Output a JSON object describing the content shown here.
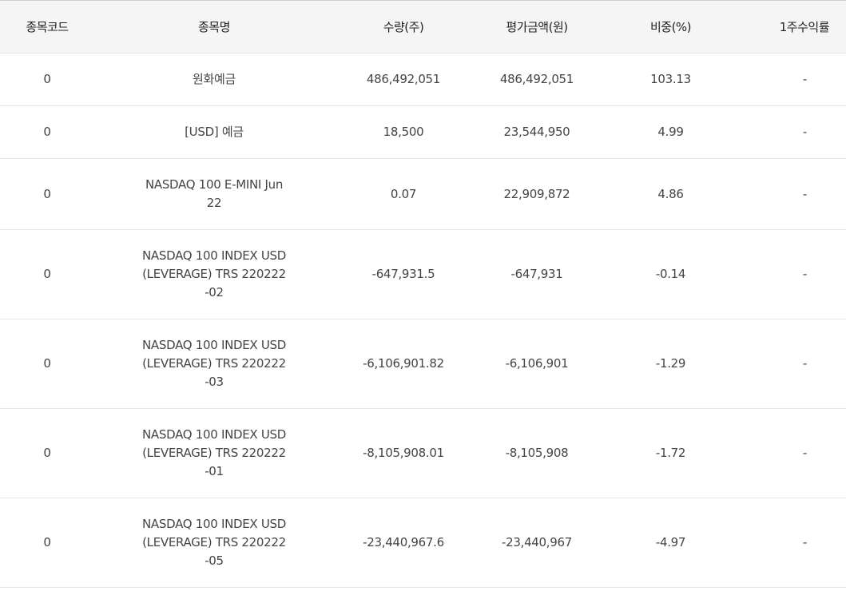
{
  "table": {
    "headers": [
      "종목코드",
      "종목명",
      "수량(주)",
      "평가금액(원)",
      "비중(%)",
      "1주수익률"
    ],
    "rows": [
      {
        "code": "0",
        "name": "원화예금",
        "qty": "486,492,051",
        "value": "486,492,051",
        "weight": "103.13",
        "ret": "-"
      },
      {
        "code": "0",
        "name": "[USD] 예금",
        "qty": "18,500",
        "value": "23,544,950",
        "weight": "4.99",
        "ret": "-"
      },
      {
        "code": "0",
        "name": "NASDAQ 100 E-MINI Jun 22",
        "qty": "0.07",
        "value": "22,909,872",
        "weight": "4.86",
        "ret": "-"
      },
      {
        "code": "0",
        "name": "NASDAQ 100 INDEX USD (LEVERAGE) TRS 220222 -02",
        "qty": "-647,931.5",
        "value": "-647,931",
        "weight": "-0.14",
        "ret": "-"
      },
      {
        "code": "0",
        "name": "NASDAQ 100 INDEX USD (LEVERAGE) TRS 220222 -03",
        "qty": "-6,106,901.82",
        "value": "-6,106,901",
        "weight": "-1.29",
        "ret": "-"
      },
      {
        "code": "0",
        "name": "NASDAQ 100 INDEX USD (LEVERAGE) TRS 220222 -01",
        "qty": "-8,105,908.01",
        "value": "-8,105,908",
        "weight": "-1.72",
        "ret": "-"
      },
      {
        "code": "0",
        "name": "NASDAQ 100 INDEX USD (LEVERAGE) TRS 220222 -05",
        "qty": "-23,440,967.6",
        "value": "-23,440,967",
        "weight": "-4.97",
        "ret": "-"
      }
    ]
  }
}
